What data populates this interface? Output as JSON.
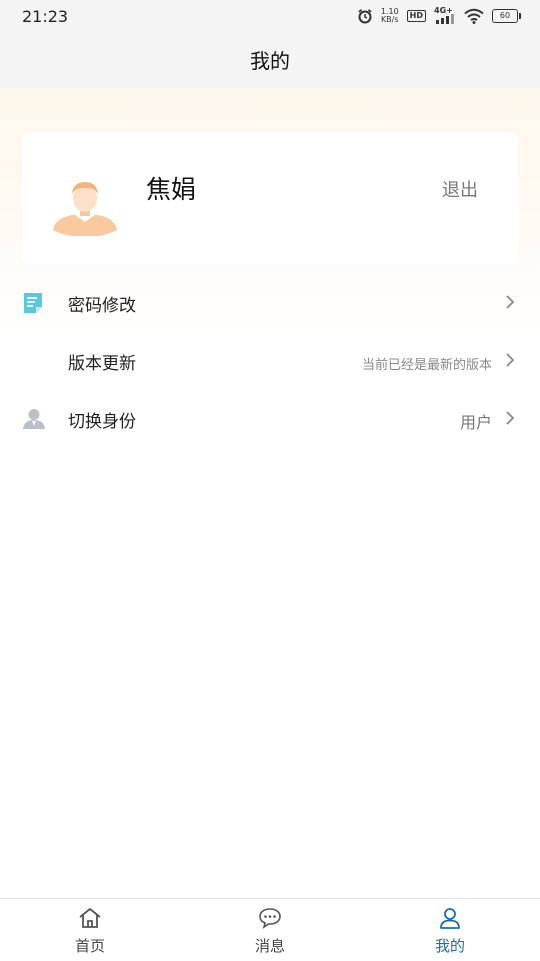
{
  "status_bar": {
    "time": "21:23",
    "net_speed_value": "1.10",
    "net_speed_unit": "KB/s",
    "hd_label": "HD",
    "network_label": "4G+",
    "battery_level": "60"
  },
  "header": {
    "title": "我的"
  },
  "profile": {
    "name": "焦娟",
    "logout_label": "退出"
  },
  "menu": [
    {
      "label": "密码修改",
      "value": "",
      "icon": "document-icon"
    },
    {
      "label": "版本更新",
      "value": "当前已经是最新的版本",
      "icon": ""
    },
    {
      "label": "切换身份",
      "value": "用户",
      "icon": "person-icon"
    }
  ],
  "tabs": [
    {
      "label": "首页",
      "icon": "home-icon",
      "active": false
    },
    {
      "label": "消息",
      "icon": "message-icon",
      "active": false
    },
    {
      "label": "我的",
      "icon": "profile-icon",
      "active": true
    }
  ],
  "colors": {
    "accent": "#1a6fa6",
    "secondary_text": "#888888",
    "header_bg": "#f4f4f4"
  }
}
